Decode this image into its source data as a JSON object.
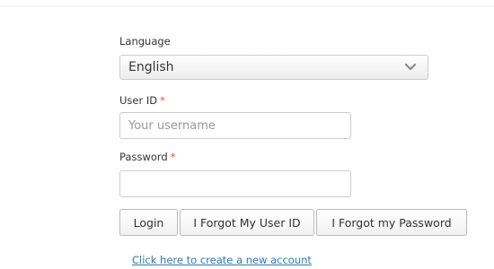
{
  "form": {
    "language": {
      "label": "Language",
      "selected": "English"
    },
    "user_id": {
      "label": "User ID",
      "required_mark": "*",
      "value": "",
      "placeholder": "Your username"
    },
    "password": {
      "label": "Password",
      "required_mark": "*",
      "value": "",
      "placeholder": ""
    },
    "buttons": {
      "login": "Login",
      "forgot_user_id": "I Forgot My User ID",
      "forgot_password": "I Forgot my Password"
    },
    "create_account_link": "Click here to create a new account"
  },
  "colors": {
    "required": "#d9534f",
    "link": "#2a7ab8"
  },
  "icons": {
    "select_arrow": "chevron-down-icon"
  }
}
